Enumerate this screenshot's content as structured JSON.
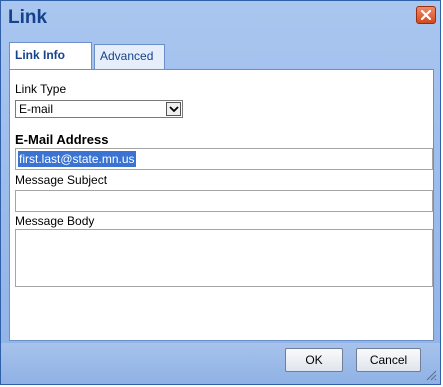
{
  "dialog": {
    "title": "Link",
    "close_icon": "close-icon"
  },
  "tabs": [
    {
      "label": "Link Info",
      "active": true
    },
    {
      "label": "Advanced",
      "active": false
    }
  ],
  "form": {
    "link_type_label": "Link Type",
    "link_type_value": "E-mail",
    "email_label": "E-Mail Address",
    "email_value": "first.last@state.mn.us",
    "subject_label": "Message Subject",
    "subject_value": "",
    "body_label": "Message Body",
    "body_value": ""
  },
  "buttons": {
    "ok": "OK",
    "cancel": "Cancel"
  },
  "colors": {
    "title": "#15428b",
    "selection": "#3a73d2",
    "close_button": "#d24a1e"
  }
}
